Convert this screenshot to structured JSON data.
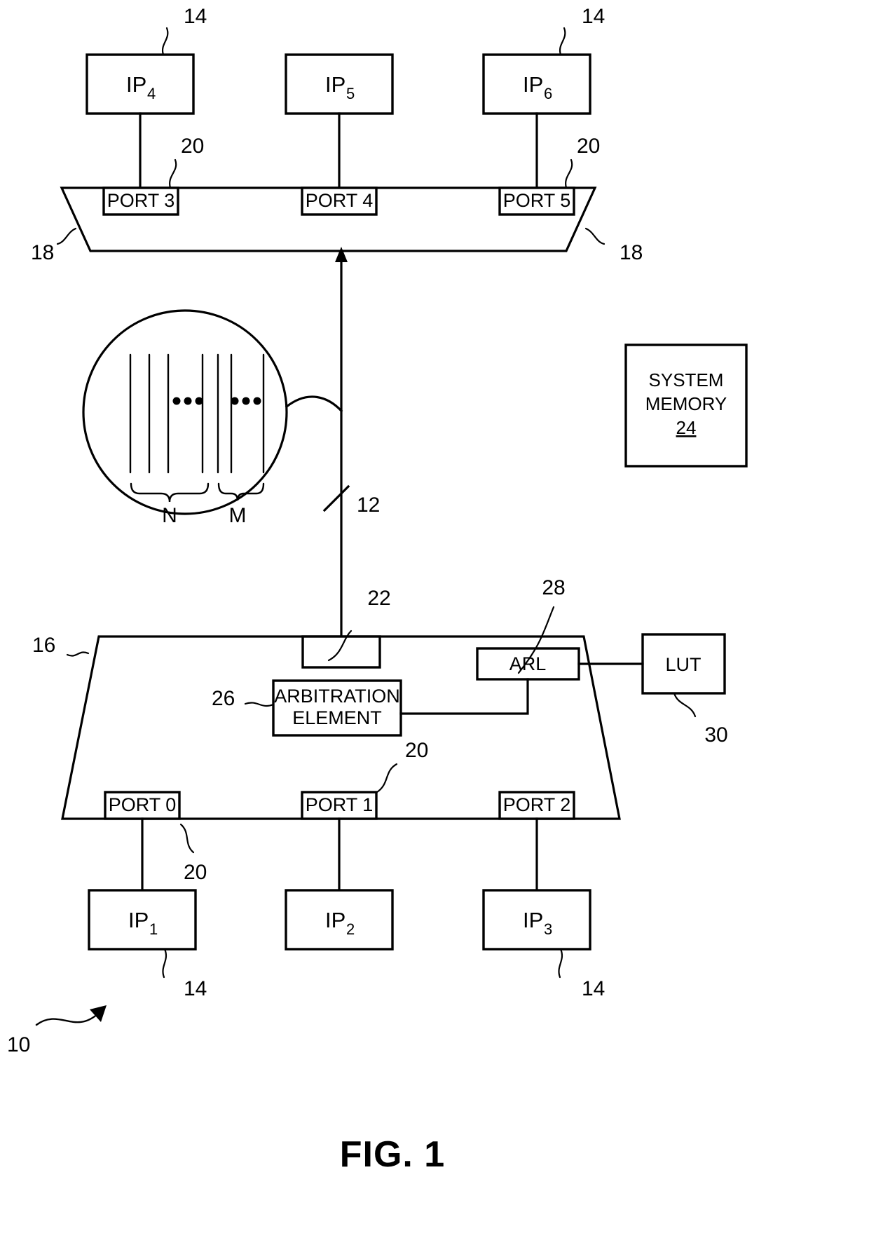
{
  "figure": {
    "caption": "FIG. 1",
    "overall_ref": "10"
  },
  "top_switch": {
    "ref_left": "18",
    "ref_right": "18",
    "ports": [
      {
        "label": "PORT 3",
        "ref": "20"
      },
      {
        "label": "PORT 4",
        "ref": ""
      },
      {
        "label": "PORT 5",
        "ref": "20"
      }
    ]
  },
  "top_ip_blocks": [
    {
      "name": "IP",
      "sub": "4",
      "ref": "14"
    },
    {
      "name": "IP",
      "sub": "5",
      "ref": ""
    },
    {
      "name": "IP",
      "sub": "6",
      "ref": "14"
    }
  ],
  "bus": {
    "ref": "12",
    "detail": {
      "group_n_label": "N",
      "group_m_label": "M",
      "ellipsis": "•••"
    }
  },
  "system_memory": {
    "line1": "SYSTEM",
    "line2": "MEMORY",
    "ref": "24"
  },
  "bottom_switch": {
    "ref": "16",
    "interface_ref": "22",
    "ports": [
      {
        "label": "PORT 0",
        "ref": "20"
      },
      {
        "label": "PORT 1",
        "ref": "20"
      },
      {
        "label": "PORT 2",
        "ref": ""
      }
    ],
    "arbitration": {
      "line1": "ARBITRATION",
      "line2": "ELEMENT",
      "ref": "26"
    },
    "arl": {
      "label": "ARL",
      "ref": "28"
    },
    "lut": {
      "label": "LUT",
      "ref": "30"
    }
  },
  "bottom_ip_blocks": [
    {
      "name": "IP",
      "sub": "1",
      "ref": "14"
    },
    {
      "name": "IP",
      "sub": "2",
      "ref": ""
    },
    {
      "name": "IP",
      "sub": "3",
      "ref": "14"
    }
  ]
}
